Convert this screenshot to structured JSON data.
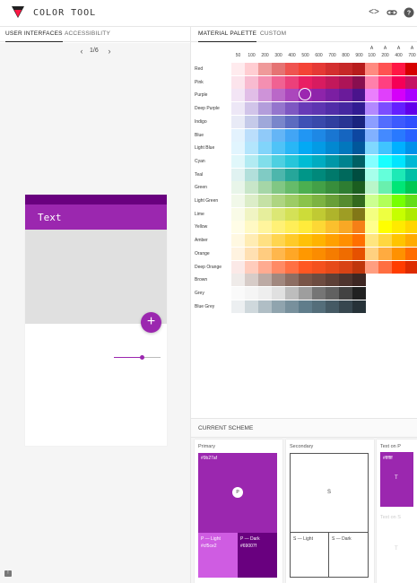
{
  "header": {
    "title": "COLOR TOOL",
    "icons": [
      "code-icon",
      "link-icon",
      "help-icon"
    ],
    "logo_colors": [
      "#212121",
      "#ff1744"
    ]
  },
  "left_tabs": [
    {
      "label": "USER INTERFACES",
      "active": true
    },
    {
      "label": "ACCESSIBILITY",
      "active": false
    }
  ],
  "right_tabs": [
    {
      "label": "MATERIAL PALETTE",
      "active": true
    },
    {
      "label": "CUSTOM",
      "active": false
    }
  ],
  "pager": {
    "text": "1/6"
  },
  "preview": {
    "app_title": "Text",
    "fab_symbol": "+",
    "slider_value": 0.55,
    "colors": {
      "primary": "#9b27af",
      "primary_dark": "#69007f",
      "surface": "#e0e0e0"
    }
  },
  "palette": {
    "shades": [
      "50",
      "100",
      "200",
      "300",
      "400",
      "500",
      "600",
      "700",
      "800",
      "900"
    ],
    "accent_prefix": "A",
    "accents": [
      "100",
      "200",
      "400",
      "700"
    ],
    "selected": {
      "row": "Purple",
      "shade": "500"
    },
    "rows": [
      {
        "name": "Red",
        "colors": [
          "#ffebee",
          "#ffcdd2",
          "#ef9a9a",
          "#e57373",
          "#ef5350",
          "#f44336",
          "#e53935",
          "#d32f2f",
          "#c62828",
          "#b71c1c"
        ],
        "accent": [
          "#ff8a80",
          "#ff5252",
          "#ff1744",
          "#d50000"
        ]
      },
      {
        "name": "Pink",
        "colors": [
          "#fce4ec",
          "#f8bbd0",
          "#f48fb1",
          "#f06292",
          "#ec407a",
          "#e91e63",
          "#d81b60",
          "#c2185b",
          "#ad1457",
          "#880e4f"
        ],
        "accent": [
          "#ff80ab",
          "#ff4081",
          "#f50057",
          "#c51162"
        ]
      },
      {
        "name": "Purple",
        "colors": [
          "#f3e5f5",
          "#e1bee7",
          "#ce93d8",
          "#ba68c8",
          "#ab47bc",
          "#9c27b0",
          "#8e24aa",
          "#7b1fa2",
          "#6a1b9a",
          "#4a148c"
        ],
        "accent": [
          "#ea80fc",
          "#e040fb",
          "#d500f9",
          "#aa00ff"
        ]
      },
      {
        "name": "Deep Purple",
        "colors": [
          "#ede7f6",
          "#d1c4e9",
          "#b39ddb",
          "#9575cd",
          "#7e57c2",
          "#673ab7",
          "#5e35b1",
          "#512da8",
          "#4527a0",
          "#311b92"
        ],
        "accent": [
          "#b388ff",
          "#7c4dff",
          "#651fff",
          "#6200ea"
        ]
      },
      {
        "name": "Indigo",
        "colors": [
          "#e8eaf6",
          "#c5cae9",
          "#9fa8da",
          "#7986cb",
          "#5c6bc0",
          "#3f51b5",
          "#3949ab",
          "#303f9f",
          "#283593",
          "#1a237e"
        ],
        "accent": [
          "#8c9eff",
          "#536dfe",
          "#3d5afe",
          "#304ffe"
        ]
      },
      {
        "name": "Blue",
        "colors": [
          "#e3f2fd",
          "#bbdefb",
          "#90caf9",
          "#64b5f6",
          "#42a5f5",
          "#2196f3",
          "#1e88e5",
          "#1976d2",
          "#1565c0",
          "#0d47a1"
        ],
        "accent": [
          "#82b1ff",
          "#448aff",
          "#2979ff",
          "#2962ff"
        ]
      },
      {
        "name": "Light Blue",
        "colors": [
          "#e1f5fe",
          "#b3e5fc",
          "#81d4fa",
          "#4fc3f7",
          "#29b6f6",
          "#03a9f4",
          "#039be5",
          "#0288d1",
          "#0277bd",
          "#01579b"
        ],
        "accent": [
          "#80d8ff",
          "#40c4ff",
          "#00b0ff",
          "#0091ea"
        ]
      },
      {
        "name": "Cyan",
        "colors": [
          "#e0f7fa",
          "#b2ebf2",
          "#80deea",
          "#4dd0e1",
          "#26c6da",
          "#00bcd4",
          "#00acc1",
          "#0097a7",
          "#00838f",
          "#006064"
        ],
        "accent": [
          "#84ffff",
          "#18ffff",
          "#00e5ff",
          "#00b8d4"
        ]
      },
      {
        "name": "Teal",
        "colors": [
          "#e0f2f1",
          "#b2dfdb",
          "#80cbc4",
          "#4db6ac",
          "#26a69a",
          "#009688",
          "#00897b",
          "#00796b",
          "#00695c",
          "#004d40"
        ],
        "accent": [
          "#a7ffeb",
          "#64ffda",
          "#1de9b6",
          "#00bfa5"
        ]
      },
      {
        "name": "Green",
        "colors": [
          "#e8f5e9",
          "#c8e6c9",
          "#a5d6a7",
          "#81c784",
          "#66bb6a",
          "#4caf50",
          "#43a047",
          "#388e3c",
          "#2e7d32",
          "#1b5e20"
        ],
        "accent": [
          "#b9f6ca",
          "#69f0ae",
          "#00e676",
          "#00c853"
        ]
      },
      {
        "name": "Light Green",
        "colors": [
          "#f1f8e9",
          "#dcedc8",
          "#c5e1a5",
          "#aed581",
          "#9ccc65",
          "#8bc34a",
          "#7cb342",
          "#689f38",
          "#558b2f",
          "#33691e"
        ],
        "accent": [
          "#ccff90",
          "#b2ff59",
          "#76ff03",
          "#64dd17"
        ]
      },
      {
        "name": "Lime",
        "colors": [
          "#f9fbe7",
          "#f0f4c3",
          "#e6ee9c",
          "#dce775",
          "#d4e157",
          "#cddc39",
          "#c0ca33",
          "#afb42b",
          "#9e9d24",
          "#827717"
        ],
        "accent": [
          "#f4ff81",
          "#eeff41",
          "#c6ff00",
          "#aeea00"
        ]
      },
      {
        "name": "Yellow",
        "colors": [
          "#fffde7",
          "#fff9c4",
          "#fff59d",
          "#fff176",
          "#ffee58",
          "#ffeb3b",
          "#fdd835",
          "#fbc02d",
          "#f9a825",
          "#f57f17"
        ],
        "accent": [
          "#ffff8d",
          "#ffff00",
          "#ffea00",
          "#ffd600"
        ]
      },
      {
        "name": "Amber",
        "colors": [
          "#fff8e1",
          "#ffecb3",
          "#ffe082",
          "#ffd54f",
          "#ffca28",
          "#ffc107",
          "#ffb300",
          "#ffa000",
          "#ff8f00",
          "#ff6f00"
        ],
        "accent": [
          "#ffe57f",
          "#ffd740",
          "#ffc400",
          "#ffab00"
        ]
      },
      {
        "name": "Orange",
        "colors": [
          "#fff3e0",
          "#ffe0b2",
          "#ffcc80",
          "#ffb74d",
          "#ffa726",
          "#ff9800",
          "#fb8c00",
          "#f57c00",
          "#ef6c00",
          "#e65100"
        ],
        "accent": [
          "#ffd180",
          "#ffab40",
          "#ff9100",
          "#ff6d00"
        ]
      },
      {
        "name": "Deep Orange",
        "colors": [
          "#fbe9e7",
          "#ffccbc",
          "#ffab91",
          "#ff8a65",
          "#ff7043",
          "#ff5722",
          "#f4511e",
          "#e64a19",
          "#d84315",
          "#bf360c"
        ],
        "accent": [
          "#ff9e80",
          "#ff6e40",
          "#ff3d00",
          "#dd2c00"
        ]
      },
      {
        "name": "Brown",
        "colors": [
          "#efebe9",
          "#d7ccc8",
          "#bcaaa4",
          "#a1887f",
          "#8d6e63",
          "#795548",
          "#6d4c41",
          "#5d4037",
          "#4e342e",
          "#3e2723"
        ],
        "accent": []
      },
      {
        "name": "Grey",
        "colors": [
          "#fafafa",
          "#f5f5f5",
          "#eeeeee",
          "#e0e0e0",
          "#bdbdbd",
          "#9e9e9e",
          "#757575",
          "#616161",
          "#424242",
          "#212121"
        ],
        "accent": []
      },
      {
        "name": "Blue Grey",
        "colors": [
          "#eceff1",
          "#cfd8dc",
          "#b0bec5",
          "#90a4ae",
          "#78909c",
          "#607d8b",
          "#546e7a",
          "#455a64",
          "#37474f",
          "#263238"
        ],
        "accent": []
      }
    ]
  },
  "scheme": {
    "header": "CURRENT SCHEME",
    "primary": {
      "label": "Primary",
      "hex": "#9b27af",
      "badge": "P",
      "light_label": "P — Light",
      "light_hex": "#cf5ce2",
      "dark_label": "P — Dark",
      "dark_hex": "#69007f"
    },
    "secondary": {
      "label": "Secondary",
      "badge": "S",
      "light_label": "S — Light",
      "dark_label": "S — Dark"
    },
    "text_on_p": {
      "label": "Text on P",
      "hex": "#ffffff",
      "letter": "T"
    },
    "text_on_s": {
      "label": "Text on S",
      "letter": "T"
    }
  }
}
